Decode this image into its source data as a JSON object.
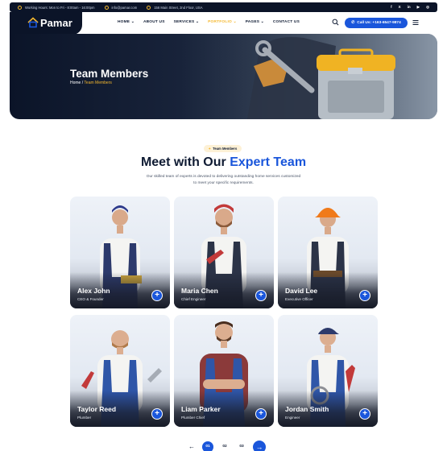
{
  "topbar": {
    "hours": "Working Hours: Mon to Fri - 8:00am - 16:00pm",
    "email": "info@pamar.com",
    "address": "156 Main Street, 2nd Floor, USA",
    "social": [
      "f",
      "X",
      "in",
      "▶",
      "◎"
    ]
  },
  "brand": {
    "name": "Pamar"
  },
  "menu": [
    {
      "label": "HOME ⌄"
    },
    {
      "label": "ABOUT US"
    },
    {
      "label": "SERVICES ⌄"
    },
    {
      "label": "PORTFOLIO ⌄"
    },
    {
      "label": "PAGES ⌄"
    },
    {
      "label": "CONTACT US"
    }
  ],
  "call": {
    "label": "Call Us: +163-6547-9874"
  },
  "hero": {
    "title": "Team Members",
    "crumb_home": "Home",
    "crumb_sep": " / ",
    "crumb_current": "Team Members"
  },
  "section": {
    "badge": "Team Members",
    "title_main": "Meet with Our ",
    "title_accent": "Expert Team",
    "description": "Our skilled team of experts is devoted to delivering outstanding home services customized to meet your specific requirements."
  },
  "team": [
    {
      "name": "Alex John",
      "role": "CEO & Founder"
    },
    {
      "name": "Maria Chen",
      "role": "Chief Engineer"
    },
    {
      "name": "David Lee",
      "role": "Executive Officer"
    },
    {
      "name": "Taylor Reed",
      "role": "Plumber"
    },
    {
      "name": "Liam Parker",
      "role": "Plumber Chief"
    },
    {
      "name": "Jordan Smith",
      "role": "Engineer"
    }
  ],
  "pager": {
    "prev": "←",
    "pages": [
      "01",
      "02",
      "03"
    ],
    "active": "01",
    "next": "→"
  },
  "colors": {
    "navy": "#0b1428",
    "accent_blue": "#1a56db",
    "accent_yellow": "#f5b82e"
  }
}
